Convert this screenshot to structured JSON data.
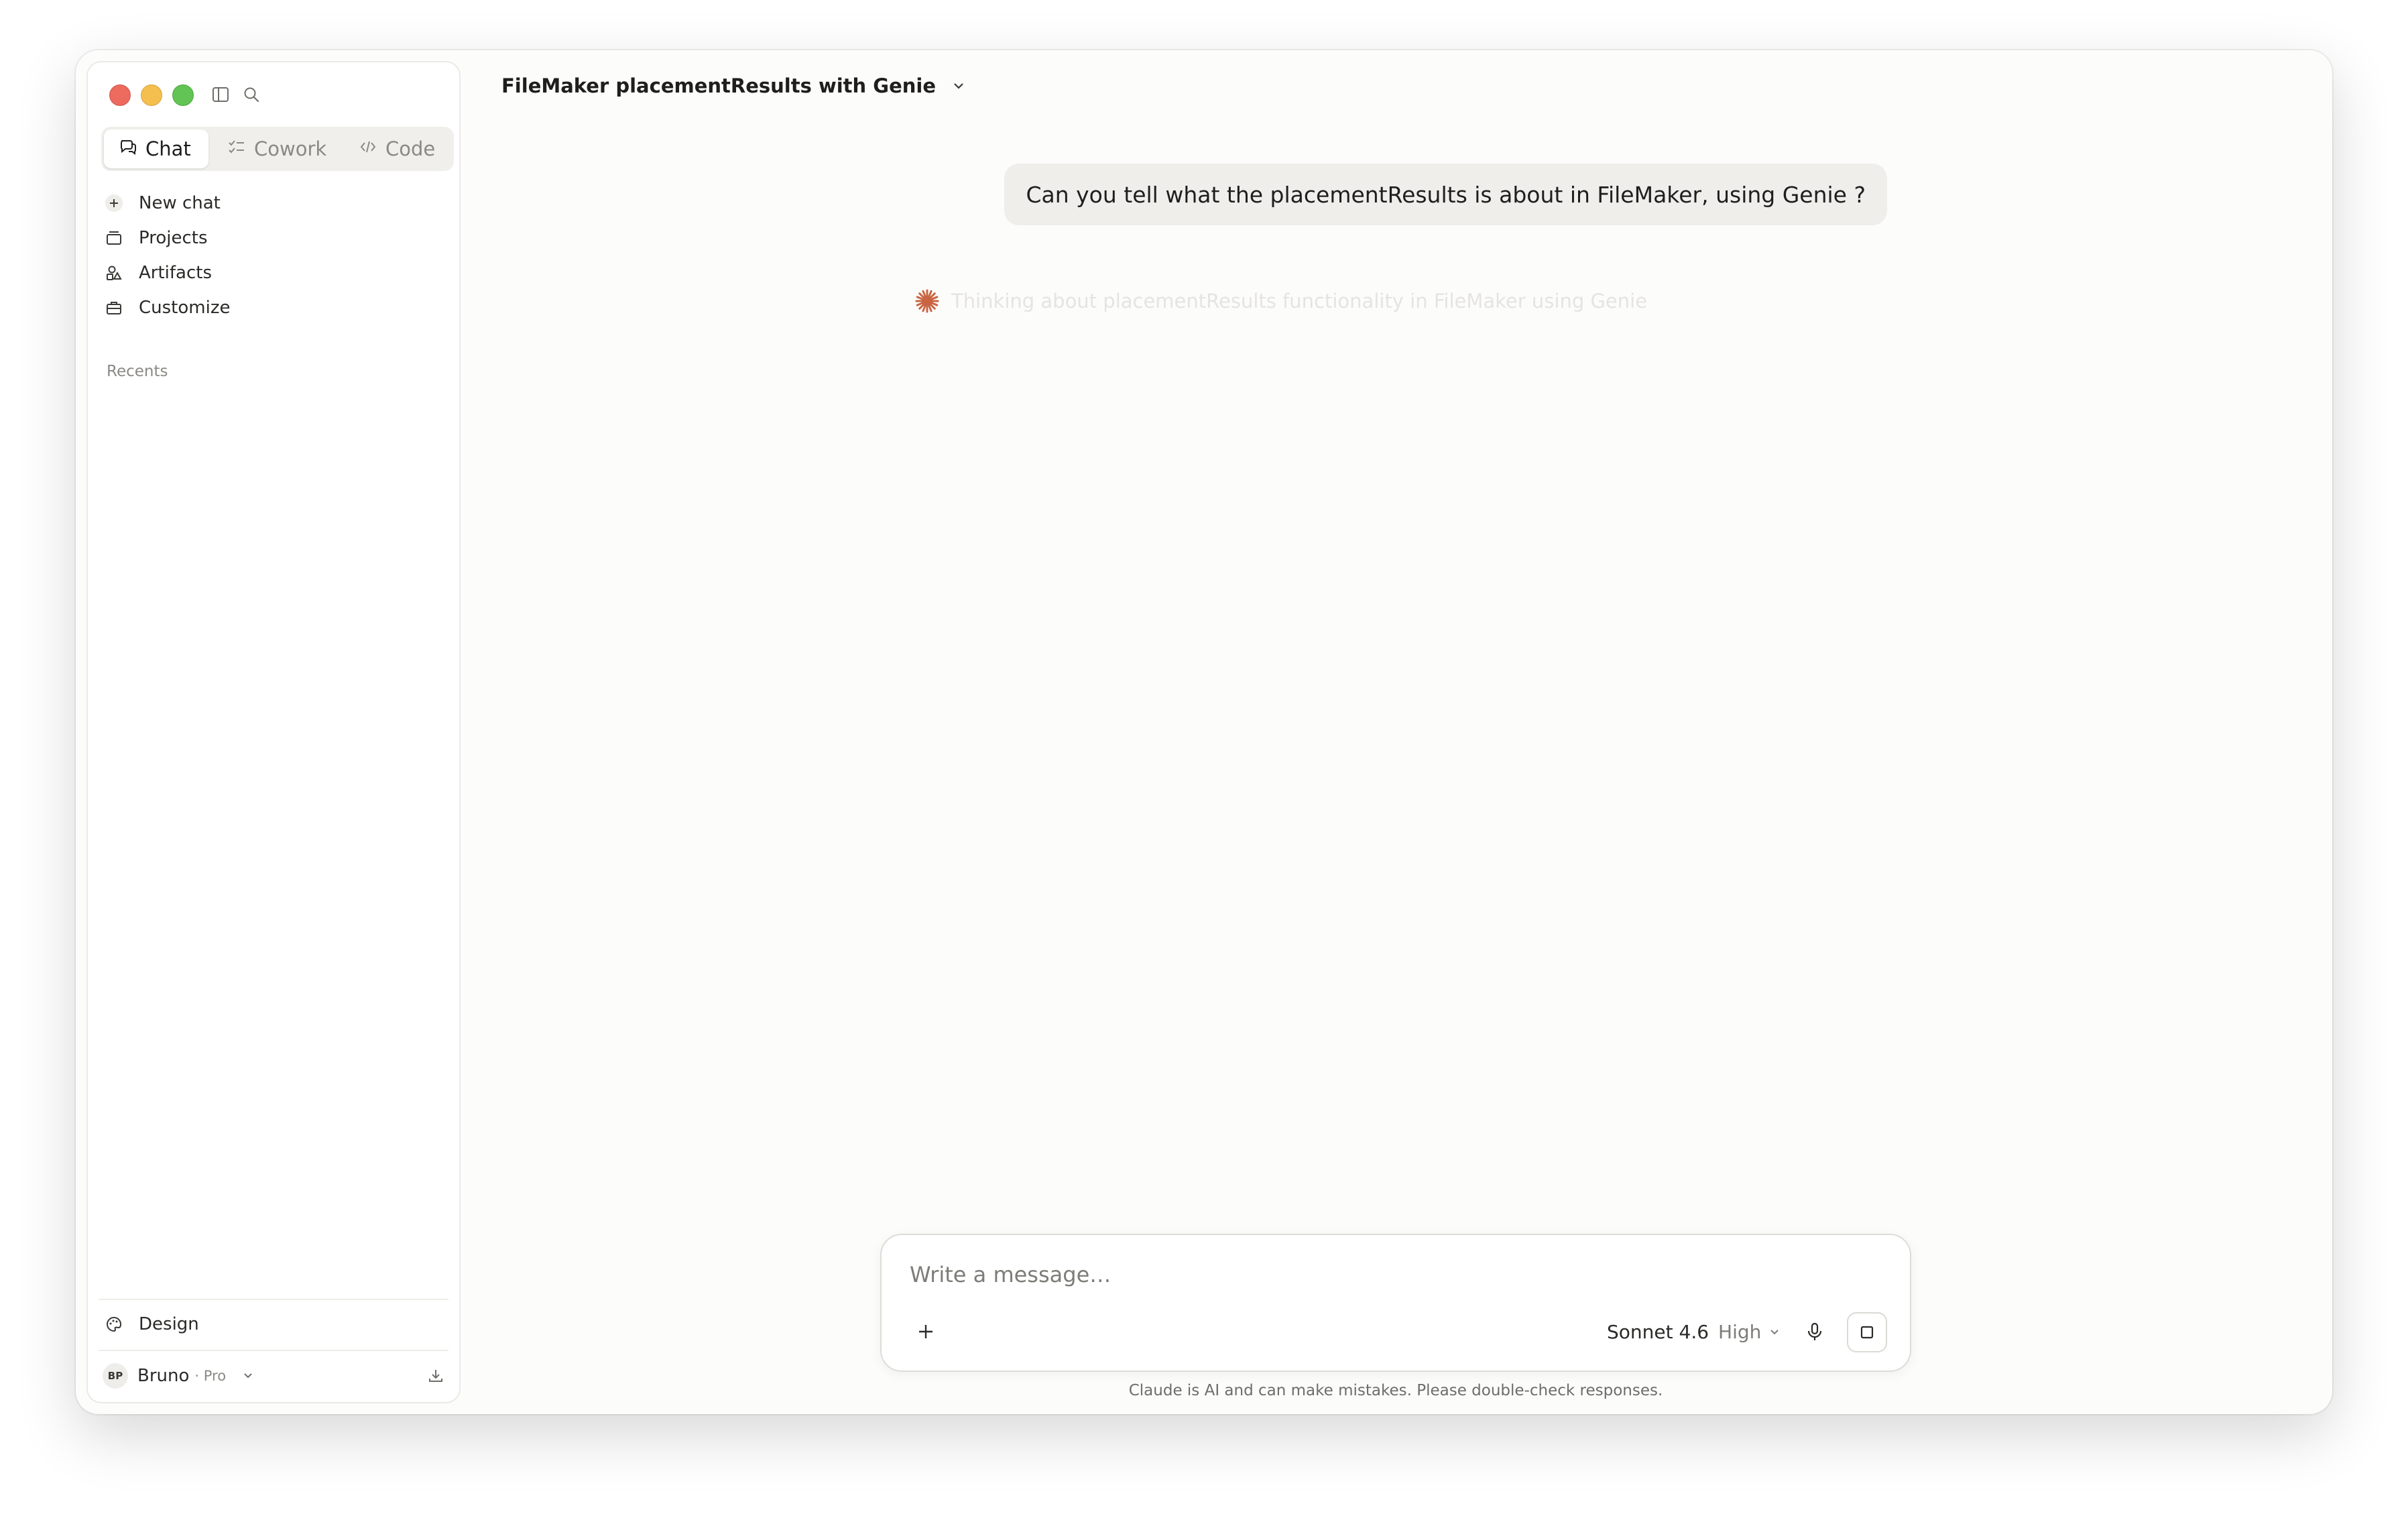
{
  "sidebar": {
    "modes": [
      {
        "label": "Chat",
        "active": true
      },
      {
        "label": "Cowork",
        "active": false
      },
      {
        "label": "Code",
        "active": false
      }
    ],
    "nav": [
      {
        "label": "New chat",
        "icon": "plus-icon"
      },
      {
        "label": "Projects",
        "icon": "folder-icon"
      },
      {
        "label": "Artifacts",
        "icon": "artifacts-icon"
      },
      {
        "label": "Customize",
        "icon": "briefcase-icon"
      }
    ],
    "recents_label": "Recents",
    "design_label": "Design",
    "user": {
      "initials": "BP",
      "name": "Bruno",
      "plan": "· Pro"
    }
  },
  "header": {
    "title": "FileMaker placementResults with Genie"
  },
  "conversation": {
    "user_message": "Can you tell what the placementResults is about in FileMaker,  using Genie ?",
    "thinking_text": "Thinking about placementResults functionality in FileMaker using Genie"
  },
  "composer": {
    "placeholder": "Write a message…",
    "model": "Sonnet 4.6",
    "effort": "High"
  },
  "disclaimer": "Claude is AI and can make mistakes. Please double-check responses.",
  "colors": {
    "accent": "#c96442",
    "background": "#fcfcfb",
    "sidebar": "#ffffff",
    "bubble": "#efeeeb"
  }
}
